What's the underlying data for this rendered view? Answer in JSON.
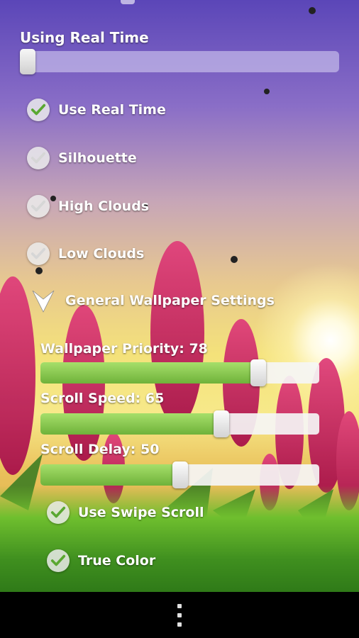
{
  "header": {
    "title": "Using Real Time",
    "slider_value": 0
  },
  "toggles": [
    {
      "label": "Use Real Time",
      "checked": true
    },
    {
      "label": "Silhouette",
      "checked": false
    },
    {
      "label": "High Clouds",
      "checked": false
    },
    {
      "label": "Low Clouds",
      "checked": false
    }
  ],
  "section": {
    "title": "General Wallpaper Settings",
    "icon": "chevron-down-icon"
  },
  "sliders": [
    {
      "label": "Wallpaper Priority: 78",
      "value": 78,
      "max": 100
    },
    {
      "label": "Scroll Speed: 65",
      "value": 65,
      "max": 100
    },
    {
      "label": "Scroll Delay: 50",
      "value": 50,
      "max": 100
    }
  ],
  "options": [
    {
      "label": "Use Swipe Scroll",
      "checked": true
    },
    {
      "label": "True Color",
      "checked": true
    }
  ],
  "navbar": {
    "icon": "overflow-menu-icon"
  },
  "colors": {
    "accent": "#7ec24a",
    "check": "#5aa832"
  }
}
